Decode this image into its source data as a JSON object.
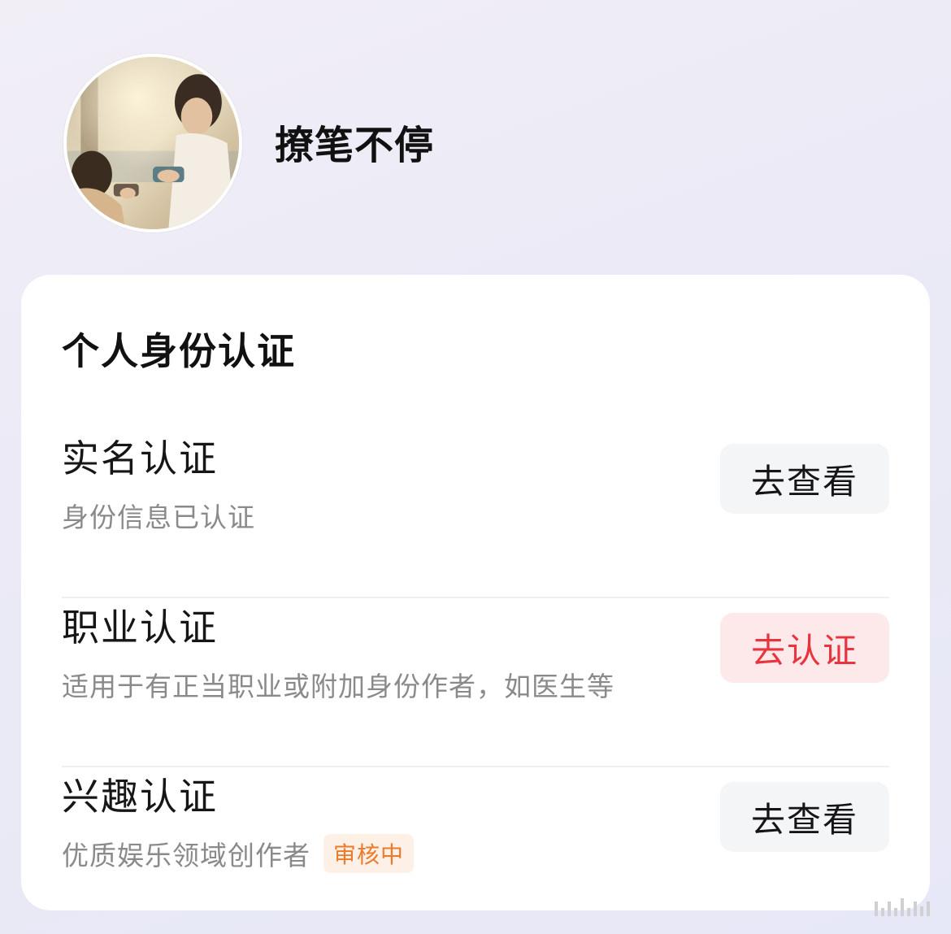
{
  "profile": {
    "username": "撩笔不停",
    "avatar_alt": "user-avatar-photo"
  },
  "card": {
    "title": "个人身份认证",
    "items": [
      {
        "title": "实名认证",
        "desc": "身份信息已认证",
        "badge": "",
        "button": "去查看",
        "button_style": "neutral"
      },
      {
        "title": "职业认证",
        "desc": "适用于有正当职业或附加身份作者，如医生等",
        "badge": "",
        "button": "去认证",
        "button_style": "primary"
      },
      {
        "title": "兴趣认证",
        "desc": "优质娱乐领域创作者",
        "badge": "审核中",
        "button": "去查看",
        "button_style": "neutral"
      }
    ]
  },
  "colors": {
    "primary_text": "#e8343f",
    "primary_bg": "#fde9ea",
    "badge_text": "#ec7a2a",
    "badge_bg": "#fdf1e7",
    "muted_text": "#8a8a8a"
  }
}
